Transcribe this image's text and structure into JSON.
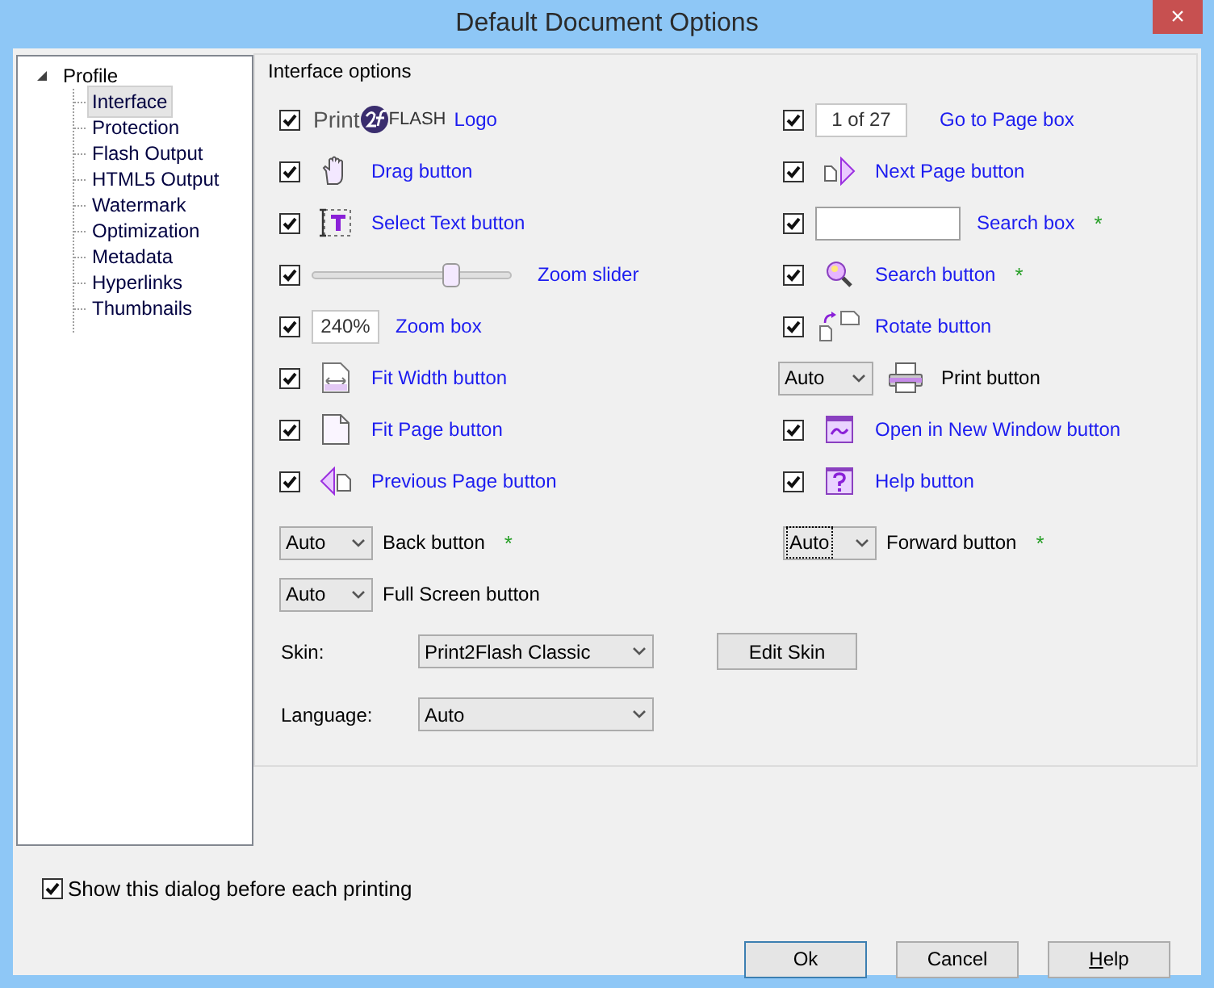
{
  "window": {
    "title": "Default Document Options",
    "close": "×"
  },
  "tree": [
    {
      "label": "Profile",
      "expanded": true,
      "selected": false,
      "children": [
        {
          "label": "Interface",
          "selected": true
        },
        {
          "label": "Protection",
          "selected": false
        },
        {
          "label": "Flash Output",
          "selected": false
        },
        {
          "label": "HTML5 Output",
          "selected": false
        },
        {
          "label": "Watermark",
          "selected": false
        },
        {
          "label": "Optimization",
          "selected": false
        },
        {
          "label": "Metadata",
          "selected": false
        },
        {
          "label": "Hyperlinks",
          "selected": false
        },
        {
          "label": "Thumbnails",
          "selected": false
        }
      ]
    }
  ],
  "group": {
    "title": "Interface options"
  },
  "left_options": [
    {
      "kind": "logo",
      "checked": true,
      "logo": {
        "word_1": "Print",
        "word_2": "FLASH"
      },
      "label": "Logo"
    },
    {
      "kind": "icon",
      "checked": true,
      "label": "Drag button"
    },
    {
      "kind": "icon",
      "checked": true,
      "label": "Select Text button"
    },
    {
      "kind": "slider",
      "checked": true,
      "level": 0.7,
      "label": "Zoom slider"
    },
    {
      "kind": "text-box",
      "checked": true,
      "value": "240%",
      "label": "Zoom box"
    },
    {
      "kind": "icon",
      "checked": true,
      "label": "Fit Width button"
    },
    {
      "kind": "icon",
      "checked": true,
      "label": "Fit Page button"
    },
    {
      "kind": "icon",
      "checked": true,
      "label": "Previous Page button"
    },
    {
      "kind": "dropdown",
      "value": "Auto",
      "focused": false,
      "label": "Back button",
      "note": "*"
    },
    {
      "kind": "dropdown",
      "value": "Auto",
      "focused": false,
      "label": "Full Screen button"
    }
  ],
  "right_options": [
    {
      "kind": "text-box",
      "checked": true,
      "value": "1 of 27",
      "label": "Go to Page box"
    },
    {
      "kind": "icon",
      "checked": true,
      "label": "Next Page button"
    },
    {
      "kind": "search-box",
      "checked": true,
      "label": "Search box",
      "note": "*"
    },
    {
      "kind": "icon",
      "checked": true,
      "label": "Search button",
      "note": "*"
    },
    {
      "kind": "icon",
      "checked": true,
      "label": "Rotate button"
    },
    {
      "kind": "dropdown-icon",
      "value": "Auto",
      "focused": false,
      "label": "Print button"
    },
    {
      "kind": "icon",
      "checked": true,
      "label": "Open in New Window button"
    },
    {
      "kind": "icon",
      "checked": true,
      "label": "Help button"
    },
    {
      "kind": "dropdown",
      "value": "Auto",
      "focused": true,
      "label": "Forward button",
      "note": "*"
    }
  ],
  "skin": {
    "label": "Skin:",
    "value": "Print2Flash Classic",
    "button": "Edit Skin"
  },
  "language": {
    "label": "Language:",
    "value": "Auto"
  },
  "show_dialog": {
    "label": "Show this dialog before each printing",
    "checked": true
  },
  "buttons": [
    {
      "label": "Ok",
      "default": true
    },
    {
      "label": "Cancel",
      "default": false
    },
    {
      "label": "Help",
      "default": false
    }
  ]
}
